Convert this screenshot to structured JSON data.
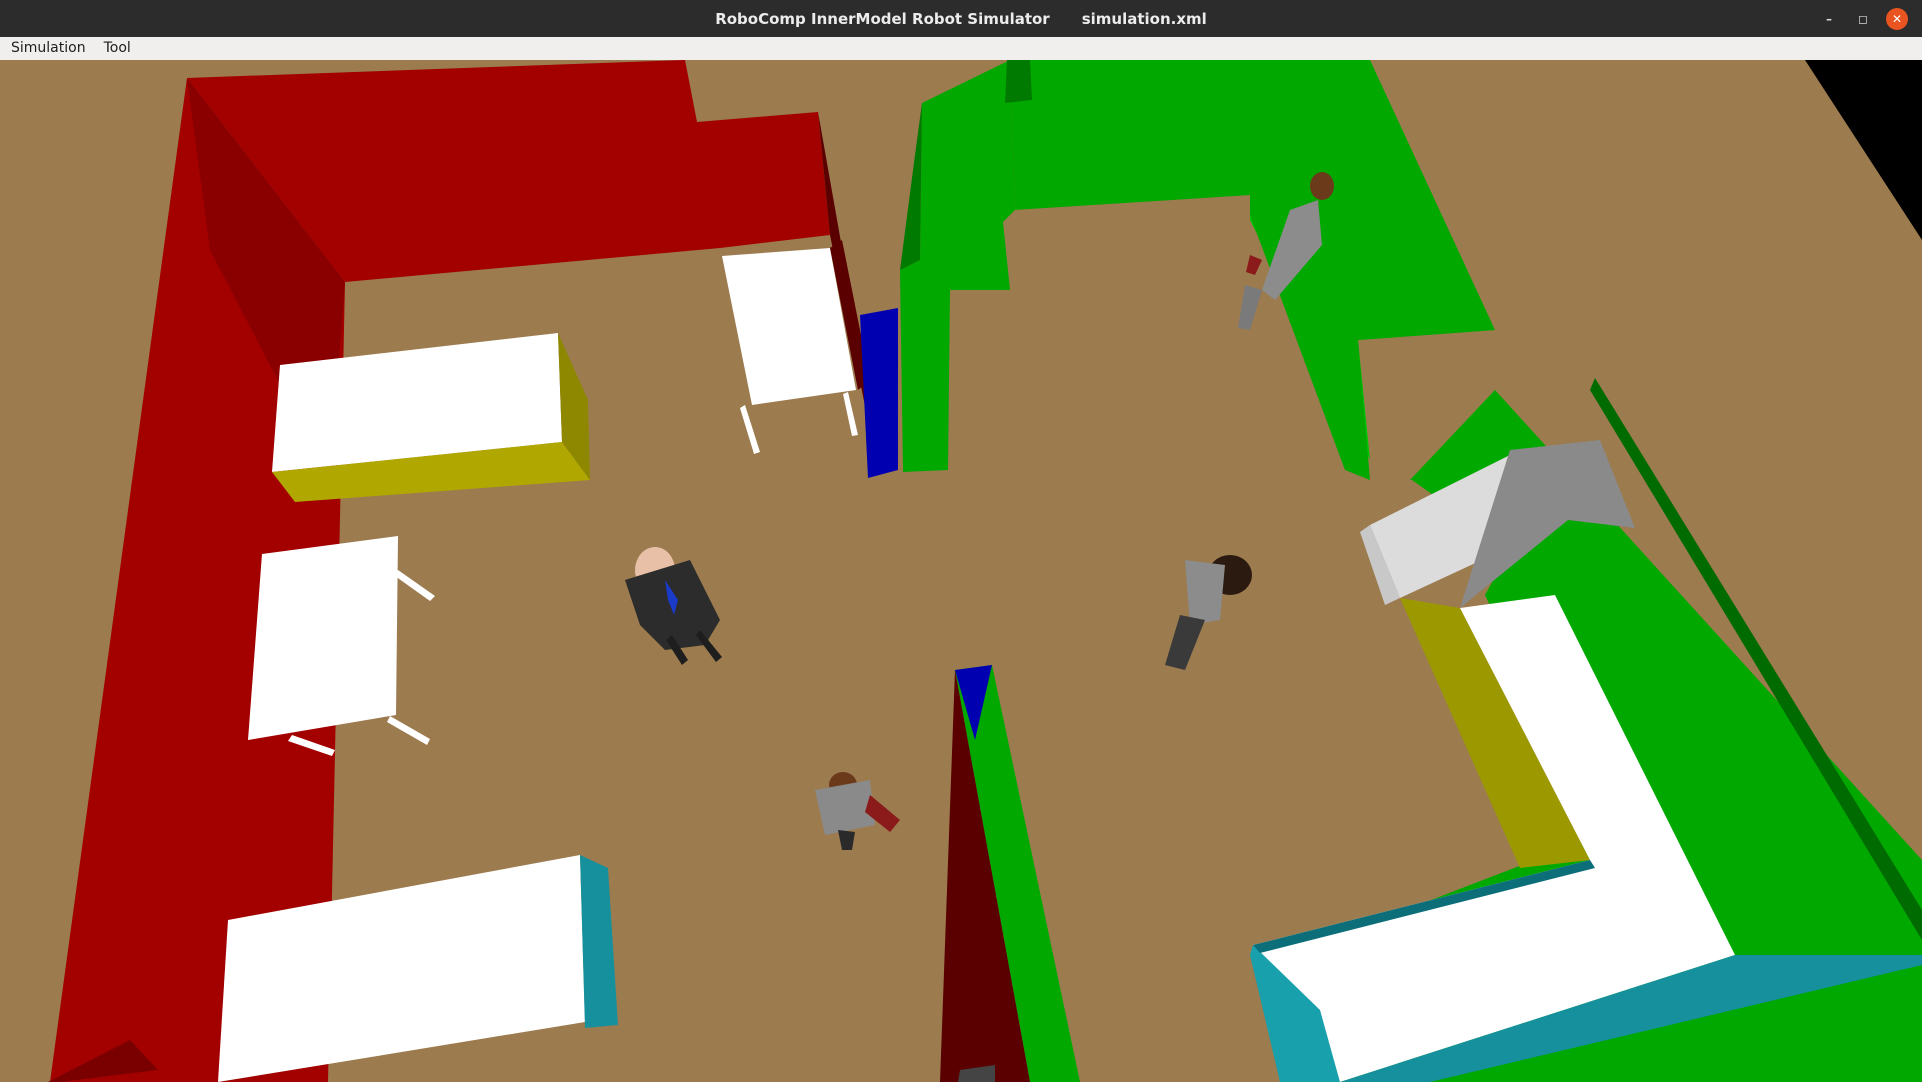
{
  "window": {
    "title_app": "RoboComp InnerModel Robot Simulator",
    "title_file": "simulation.xml",
    "controls": [
      {
        "name": "minimize-button",
        "glyph": "–"
      },
      {
        "name": "maximize-button",
        "glyph": "◻"
      },
      {
        "name": "close-button",
        "glyph": "✕"
      }
    ]
  },
  "menubar": {
    "items": [
      "Simulation",
      "Tool"
    ]
  },
  "scene": {
    "floor_color": "#9c7b4f",
    "colors": {
      "red_wall": "#a30000",
      "red_wall_dark": "#7a0000",
      "green_wall": "#00a800",
      "green_wall_dark": "#007a00",
      "blue_door": "#0000b0",
      "table_white": "#ffffff",
      "cabinet_yellow": "#a8a400",
      "cabinet_cyan": "#16909c",
      "box_gray": "#8a8a8a",
      "void": "#000000"
    },
    "humans": [
      {
        "name": "person-bald-suit",
        "outfit": "dark suit, blue tie"
      },
      {
        "name": "person-woman-gray",
        "outfit": "gray top, dark hair"
      },
      {
        "name": "person-man-briefcase",
        "outfit": "gray suit, red briefcase"
      },
      {
        "name": "person-man-corner",
        "outfit": "gray suit, red bag"
      }
    ]
  }
}
